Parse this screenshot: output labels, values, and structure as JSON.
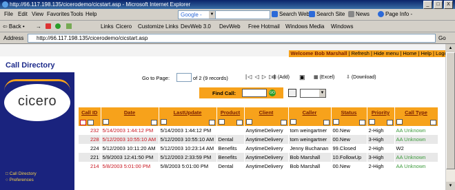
{
  "window": {
    "title": "http://66.117.198.135/cicerodemo/cicstart.asp - Microsoft Internet Explorer",
    "controls": [
      "_",
      "□",
      "X"
    ]
  },
  "menu": {
    "items": [
      "File",
      "Edit",
      "View",
      "Favorites",
      "Tools",
      "Help"
    ],
    "google": "Google -",
    "toolbar": [
      "Search Web",
      "Search Site",
      "News",
      "Page Info -"
    ]
  },
  "nav": {
    "back": "⇦ Back •",
    "links_label": "Links",
    "links": [
      "Cicero",
      "Customize Links",
      "DevWeb 3.0",
      "DevWeb",
      "Free Hotmail",
      "Windows Media",
      "Windows"
    ]
  },
  "address": {
    "label": "Address",
    "url": "http://66.117.198.135/cicerodemo/cicstart.asp",
    "go": "Go"
  },
  "page": {
    "welcome_user": "Welcome Bob Marshall",
    "welcome_links": "| Refresh | Hide menu | Home | Help | Logout",
    "title": "Call Directory",
    "logo_text": "cicero",
    "side_links": [
      "Call Directory",
      "Preferences"
    ],
    "goto_label": "Go to Page:",
    "goto_value": "",
    "page_of": "of 2 (9 records)",
    "nav_arrows": "|◁ ◁ ▷ ▷|",
    "add": "(Add)",
    "excel": "(Excel)",
    "download": "(Download)",
    "find_label": "Find Call:",
    "find_value": "",
    "find_go": "GO"
  },
  "grid": {
    "columns": [
      "Call ID",
      "Date",
      "LastUpdate",
      "Product",
      "Client",
      "Caller",
      "Status",
      "Priority",
      "Call Type"
    ],
    "rows": [
      [
        "232",
        "5/14/2003 1:44:12 PM",
        "5/14/2003 1:44:12 PM",
        "",
        "AnytimeDelivery",
        "tom weingartner",
        "00.New",
        "2-High",
        "AA Unknown"
      ],
      [
        "228",
        "5/12/2003 10:55:10 AM",
        "5/12/2003 10:55:10 AM",
        "Dental",
        "AnytimeDelivery",
        "tom weingartner",
        "00.New",
        "3-High",
        "AA Unknown"
      ],
      [
        "224",
        "5/12/2003 10:11:20 AM",
        "5/12/2003 10:23:14 AM",
        "Benefits",
        "AnytimeDelivery",
        "Jenny Buchanan",
        "99.Closed",
        "2-High",
        "W2"
      ],
      [
        "221",
        "5/9/2003 12:41:50 PM",
        "5/12/2003 2:33:59 PM",
        "Benefits",
        "AnytimeDelivery",
        "Bob Marshall",
        "10.FollowUp",
        "3-High",
        "AA Unknown"
      ],
      [
        "214",
        "5/8/2003 5:01:00 PM",
        "5/8/2003 5:01:00 PM",
        "Dental",
        "AnytimeDelivery",
        "Bob Marshall",
        "00.New",
        "2-High",
        "AA Unknown"
      ]
    ]
  },
  "colors": {
    "accent": "#f7a21b",
    "sidebar": "#1a237e",
    "id_red": "#c8141e",
    "type_green": "#3c9a3c"
  }
}
